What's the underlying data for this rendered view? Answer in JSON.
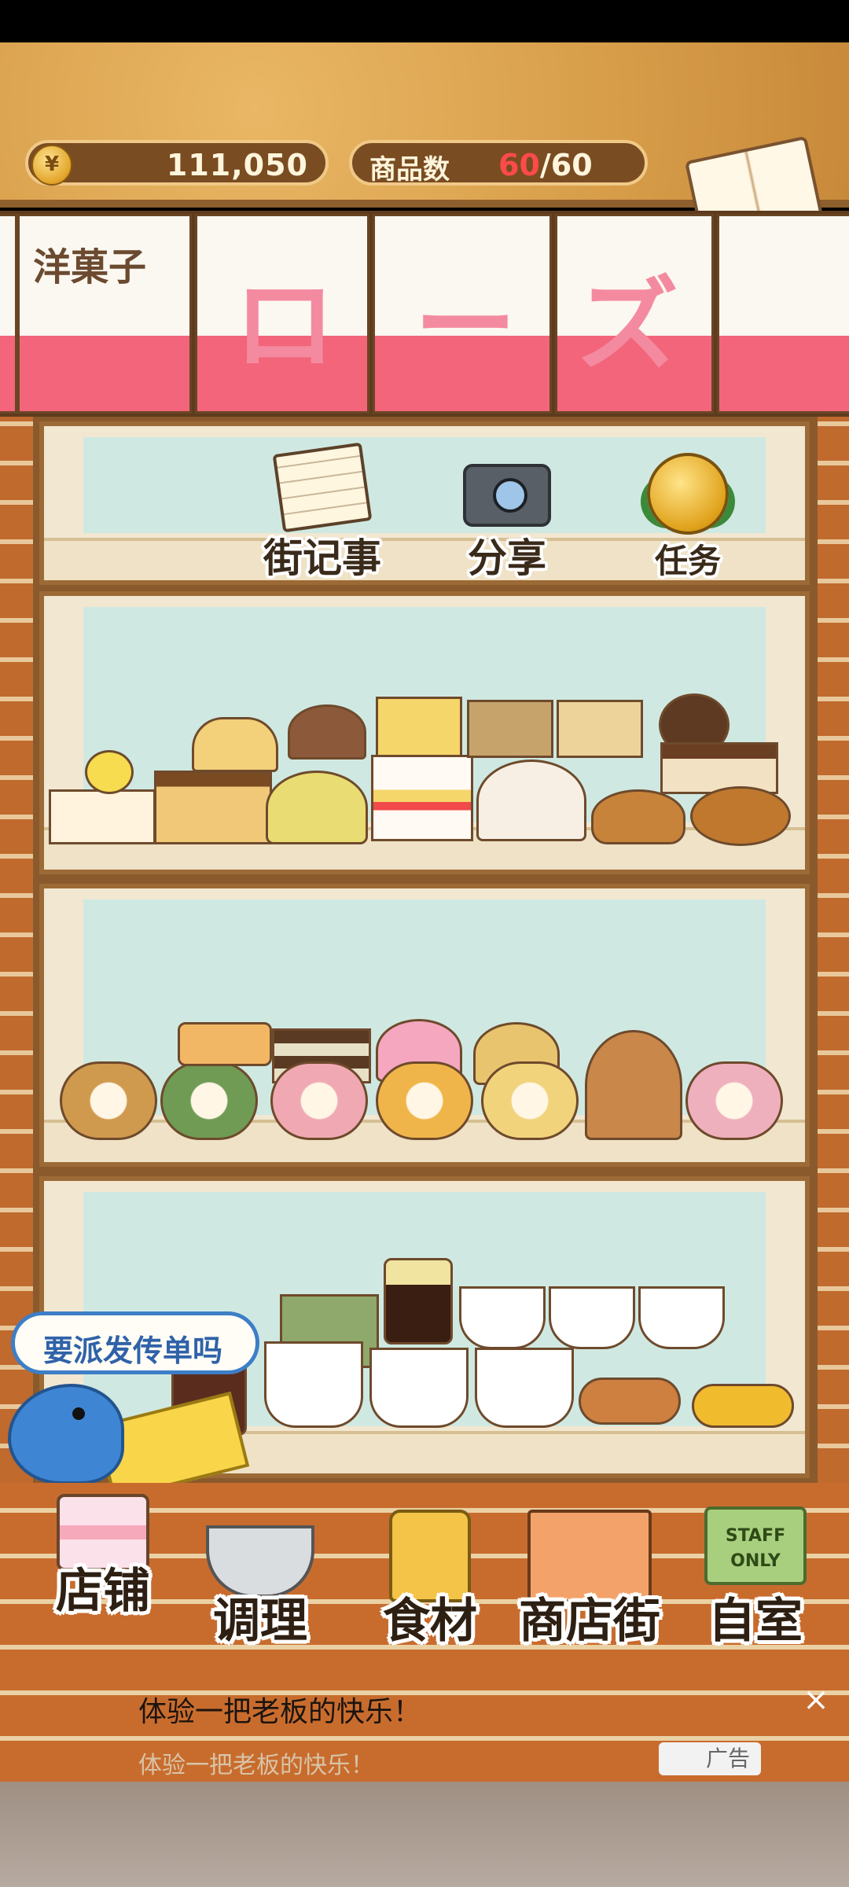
{
  "header": {
    "coin_icon": "¥",
    "money": "111,050",
    "product_count_label": "商品数",
    "product_count_current": "60",
    "product_count_sep": "/",
    "product_count_max": "60",
    "recipe_label": "食谱"
  },
  "shop_sign": {
    "small_text": "洋菓子",
    "chars": [
      "ロ",
      "ー",
      "ズ"
    ]
  },
  "features": [
    {
      "label": "街记事",
      "icon": "notepad-icon"
    },
    {
      "label": "分享",
      "icon": "camera-icon"
    },
    {
      "label": "任务",
      "icon": "medal-icon"
    }
  ],
  "flyer_prompt": "要派发传单吗",
  "nav": [
    {
      "label": "店铺",
      "icon": "cake-icon"
    },
    {
      "label": "调理",
      "icon": "mixing-bowl-icon"
    },
    {
      "label": "食材",
      "icon": "ingredients-bag-icon"
    },
    {
      "label": "商店街",
      "icon": "shop-street-icon"
    },
    {
      "label": "自室",
      "icon": "staff-only-door-icon"
    }
  ],
  "staff_sign": "STAFF ONLY",
  "ad": {
    "title": "体验一把老板的快乐！",
    "subtitle": "体验一把老板的快乐！",
    "badge": "广告",
    "close": "×"
  },
  "colors": {
    "accent_pink": "#f2657b",
    "wood": "#d79d49",
    "brick": "#c86c2e"
  }
}
